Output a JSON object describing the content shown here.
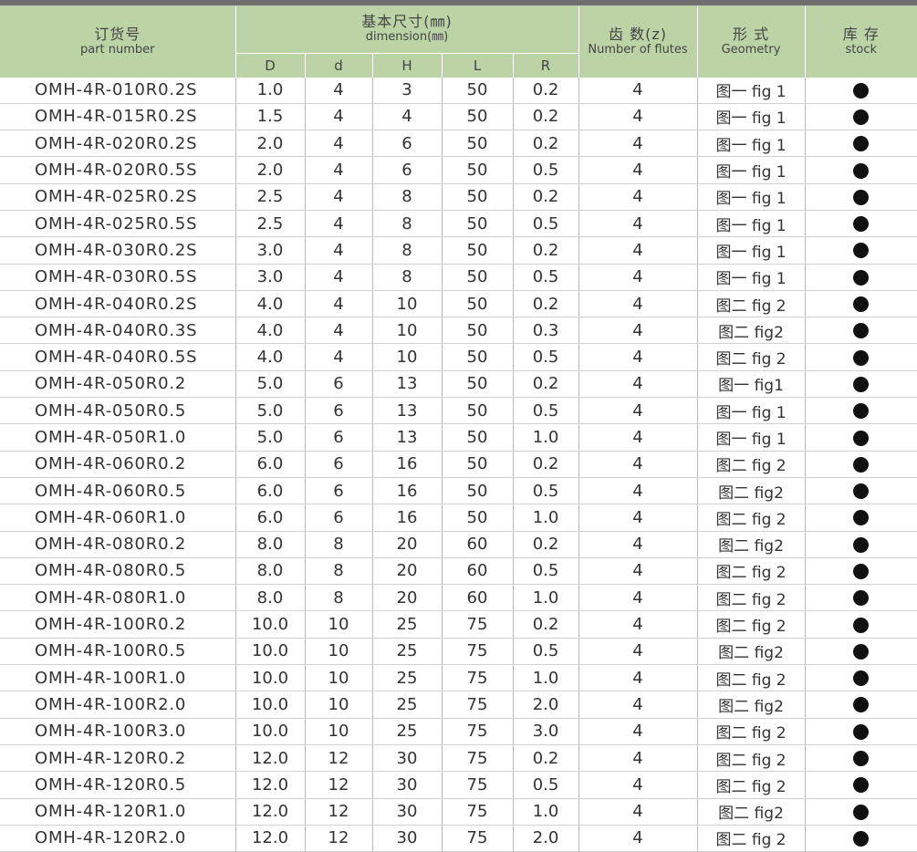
{
  "header": {
    "part_number_cn": "订货号",
    "part_number_en": "part number",
    "dimension_cn": "基本尺寸(㎜)",
    "dimension_en": "dimension(㎜)",
    "flutes_cn": "齿 数(z)",
    "flutes_en": "Number of flutes",
    "geometry_cn": "形 式",
    "geometry_en": "Geometry",
    "stock_cn": "库 存",
    "stock_en": "stock",
    "sub_columns": [
      "D",
      "d",
      "H",
      "L",
      "R"
    ]
  },
  "rows": [
    {
      "pn": "OMH-4R-010R0.2S",
      "D": "1.0",
      "d": "4",
      "H": "3",
      "L": "50",
      "R": "0.2",
      "z": "4",
      "geo": "图一 fig 1",
      "stock": "●"
    },
    {
      "pn": "OMH-4R-015R0.2S",
      "D": "1.5",
      "d": "4",
      "H": "4",
      "L": "50",
      "R": "0.2",
      "z": "4",
      "geo": "图一 fig 1",
      "stock": "●"
    },
    {
      "pn": "OMH-4R-020R0.2S",
      "D": "2.0",
      "d": "4",
      "H": "6",
      "L": "50",
      "R": "0.2",
      "z": "4",
      "geo": "图一 fig 1",
      "stock": "●"
    },
    {
      "pn": "OMH-4R-020R0.5S",
      "D": "2.0",
      "d": "4",
      "H": "6",
      "L": "50",
      "R": "0.5",
      "z": "4",
      "geo": "图一 fig 1",
      "stock": "●"
    },
    {
      "pn": "OMH-4R-025R0.2S",
      "D": "2.5",
      "d": "4",
      "H": "8",
      "L": "50",
      "R": "0.2",
      "z": "4",
      "geo": "图一 fig 1",
      "stock": "●"
    },
    {
      "pn": "OMH-4R-025R0.5S",
      "D": "2.5",
      "d": "4",
      "H": "8",
      "L": "50",
      "R": "0.5",
      "z": "4",
      "geo": "图一 fig 1",
      "stock": "●"
    },
    {
      "pn": "OMH-4R-030R0.2S",
      "D": "3.0",
      "d": "4",
      "H": "8",
      "L": "50",
      "R": "0.2",
      "z": "4",
      "geo": "图一 fig 1",
      "stock": "●"
    },
    {
      "pn": "OMH-4R-030R0.5S",
      "D": "3.0",
      "d": "4",
      "H": "8",
      "L": "50",
      "R": "0.5",
      "z": "4",
      "geo": "图一 fig 1",
      "stock": "●"
    },
    {
      "pn": "OMH-4R-040R0.2S",
      "D": "4.0",
      "d": "4",
      "H": "10",
      "L": "50",
      "R": "0.2",
      "z": "4",
      "geo": "图二 fig 2",
      "stock": "●"
    },
    {
      "pn": "OMH-4R-040R0.3S",
      "D": "4.0",
      "d": "4",
      "H": "10",
      "L": "50",
      "R": "0.3",
      "z": "4",
      "geo": "图二 fig2",
      "stock": "●"
    },
    {
      "pn": "OMH-4R-040R0.5S",
      "D": "4.0",
      "d": "4",
      "H": "10",
      "L": "50",
      "R": "0.5",
      "z": "4",
      "geo": "图二 fig 2",
      "stock": "●"
    },
    {
      "pn": "OMH-4R-050R0.2",
      "D": "5.0",
      "d": "6",
      "H": "13",
      "L": "50",
      "R": "0.2",
      "z": "4",
      "geo": "图一 fig1",
      "stock": "●"
    },
    {
      "pn": "OMH-4R-050R0.5",
      "D": "5.0",
      "d": "6",
      "H": "13",
      "L": "50",
      "R": "0.5",
      "z": "4",
      "geo": "图一 fig 1",
      "stock": "●"
    },
    {
      "pn": "OMH-4R-050R1.0",
      "D": "5.0",
      "d": "6",
      "H": "13",
      "L": "50",
      "R": "1.0",
      "z": "4",
      "geo": "图一 fig 1",
      "stock": "●"
    },
    {
      "pn": "OMH-4R-060R0.2",
      "D": "6.0",
      "d": "6",
      "H": "16",
      "L": "50",
      "R": "0.2",
      "z": "4",
      "geo": "图二 fig 2",
      "stock": "●"
    },
    {
      "pn": "OMH-4R-060R0.5",
      "D": "6.0",
      "d": "6",
      "H": "16",
      "L": "50",
      "R": "0.5",
      "z": "4",
      "geo": "图二 fig2",
      "stock": "●"
    },
    {
      "pn": "OMH-4R-060R1.0",
      "D": "6.0",
      "d": "6",
      "H": "16",
      "L": "50",
      "R": "1.0",
      "z": "4",
      "geo": "图二 fig 2",
      "stock": "●"
    },
    {
      "pn": "OMH-4R-080R0.2",
      "D": "8.0",
      "d": "8",
      "H": "20",
      "L": "60",
      "R": "0.2",
      "z": "4",
      "geo": "图二 fig2",
      "stock": "●"
    },
    {
      "pn": "OMH-4R-080R0.5",
      "D": "8.0",
      "d": "8",
      "H": "20",
      "L": "60",
      "R": "0.5",
      "z": "4",
      "geo": "图二 fig 2",
      "stock": "●"
    },
    {
      "pn": "OMH-4R-080R1.0",
      "D": "8.0",
      "d": "8",
      "H": "20",
      "L": "60",
      "R": "1.0",
      "z": "4",
      "geo": "图二 fig 2",
      "stock": "●"
    },
    {
      "pn": "OMH-4R-100R0.2",
      "D": "10.0",
      "d": "10",
      "H": "25",
      "L": "75",
      "R": "0.2",
      "z": "4",
      "geo": "图二 fig 2",
      "stock": "●"
    },
    {
      "pn": "OMH-4R-100R0.5",
      "D": "10.0",
      "d": "10",
      "H": "25",
      "L": "75",
      "R": "0.5",
      "z": "4",
      "geo": "图二 fig2",
      "stock": "●"
    },
    {
      "pn": "OMH-4R-100R1.0",
      "D": "10.0",
      "d": "10",
      "H": "25",
      "L": "75",
      "R": "1.0",
      "z": "4",
      "geo": "图二 fig 2",
      "stock": "●"
    },
    {
      "pn": "OMH-4R-100R2.0",
      "D": "10.0",
      "d": "10",
      "H": "25",
      "L": "75",
      "R": "2.0",
      "z": "4",
      "geo": "图二 fig2",
      "stock": "●"
    },
    {
      "pn": "OMH-4R-100R3.0",
      "D": "10.0",
      "d": "10",
      "H": "25",
      "L": "75",
      "R": "3.0",
      "z": "4",
      "geo": "图二 fig 2",
      "stock": "●"
    },
    {
      "pn": "OMH-4R-120R0.2",
      "D": "12.0",
      "d": "12",
      "H": "30",
      "L": "75",
      "R": "0.2",
      "z": "4",
      "geo": "图二 fig 2",
      "stock": "●"
    },
    {
      "pn": "OMH-4R-120R0.5",
      "D": "12.0",
      "d": "12",
      "H": "30",
      "L": "75",
      "R": "0.5",
      "z": "4",
      "geo": "图二 fig 2",
      "stock": "●"
    },
    {
      "pn": "OMH-4R-120R1.0",
      "D": "12.0",
      "d": "12",
      "H": "30",
      "L": "75",
      "R": "1.0",
      "z": "4",
      "geo": "图二 fig2",
      "stock": "●"
    },
    {
      "pn": "OMH-4R-120R2.0",
      "D": "12.0",
      "d": "12",
      "H": "30",
      "L": "75",
      "R": "2.0",
      "z": "4",
      "geo": "图二 fig 2",
      "stock": "●"
    }
  ]
}
